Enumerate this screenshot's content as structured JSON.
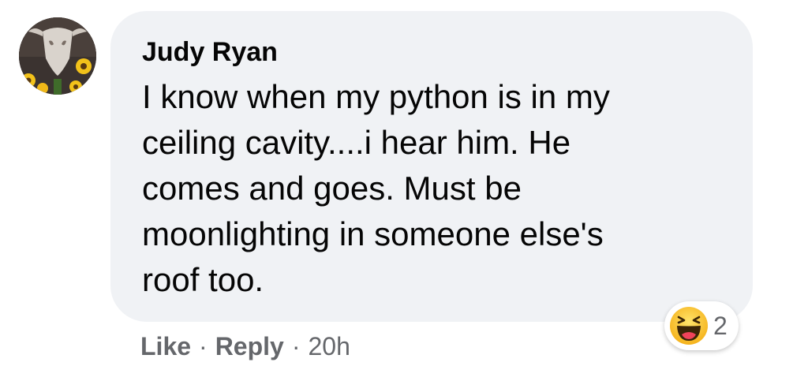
{
  "comment": {
    "author": "Judy Ryan",
    "text": "I know when my python is in my\nceiling cavity....i hear him. He\ncomes and goes. Must be\nmoonlighting in someone else's\nroof too.",
    "reaction": {
      "icon": "haha-emoji-icon",
      "count": "2"
    },
    "actions": {
      "like": "Like",
      "reply": "Reply",
      "separator": "·",
      "time": "20h"
    }
  },
  "colors": {
    "bubble": "#f0f2f5",
    "text": "#050505",
    "secondary": "#65676b"
  }
}
